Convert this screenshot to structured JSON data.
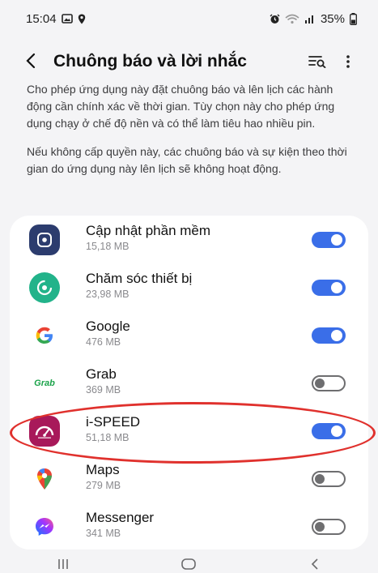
{
  "status": {
    "time": "15:04",
    "battery": "35%"
  },
  "header": {
    "title": "Chuông báo và lời nhắc"
  },
  "description": {
    "p1": "Cho phép ứng dụng này đặt chuông báo và lên lịch các hành động cần chính xác về thời gian. Tùy chọn này cho phép ứng dụng chạy ở chế độ nền và có thể làm tiêu hao nhiều pin.",
    "p2": "Nếu không cấp quyền này, các chuông báo và sự kiện theo thời gian do ứng dụng này lên lịch sẽ không hoạt động."
  },
  "apps": [
    {
      "name": "Cập nhật phần mềm",
      "size": "15,18 MB",
      "enabled": true,
      "icon": "software-update-icon"
    },
    {
      "name": "Chăm sóc thiết bị",
      "size": "23,98 MB",
      "enabled": true,
      "icon": "device-care-icon"
    },
    {
      "name": "Google",
      "size": "476 MB",
      "enabled": true,
      "icon": "google-icon"
    },
    {
      "name": "Grab",
      "size": "369 MB",
      "enabled": false,
      "icon": "grab-icon",
      "icon_text": "Grab"
    },
    {
      "name": "i-SPEED",
      "size": "51,18 MB",
      "enabled": true,
      "icon": "ispeed-icon",
      "highlighted": true
    },
    {
      "name": "Maps",
      "size": "279 MB",
      "enabled": false,
      "icon": "maps-icon"
    },
    {
      "name": "Messenger",
      "size": "341 MB",
      "enabled": false,
      "icon": "messenger-icon"
    }
  ],
  "colors": {
    "toggle_on": "#3a6ee8",
    "highlight": "#e0312d"
  }
}
